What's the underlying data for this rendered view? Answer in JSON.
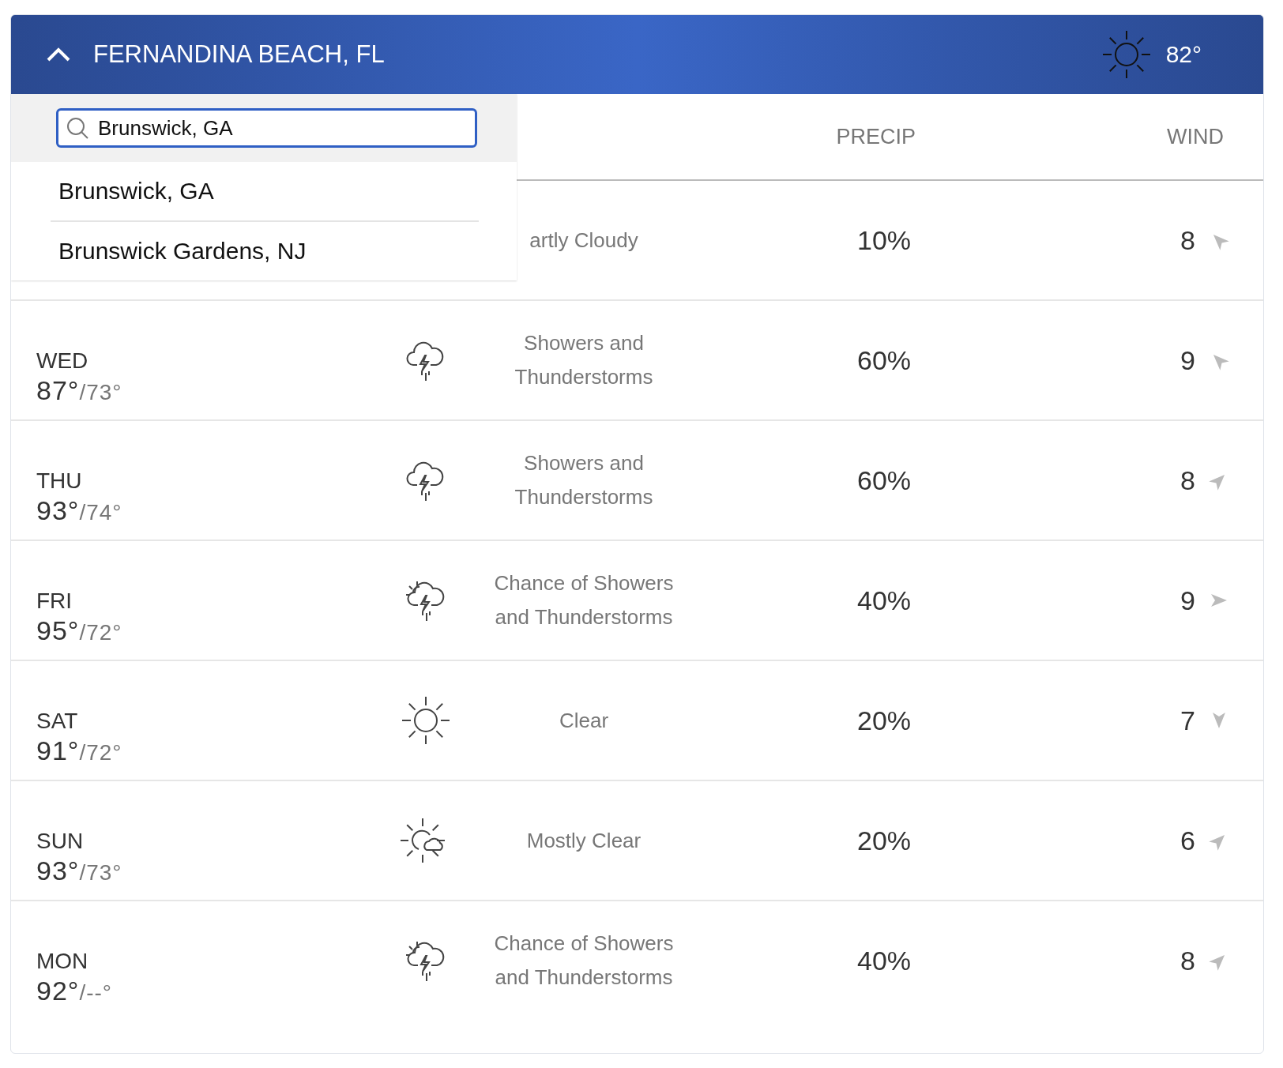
{
  "header": {
    "location": "FERNANDINA BEACH, FL",
    "expanded": true,
    "current": {
      "kind": "clear",
      "temp": "82°"
    }
  },
  "columns": [
    {
      "label": "PRECIP"
    },
    {
      "label": "WIND"
    }
  ],
  "search": {
    "value": "Brunswick, GA",
    "suggestions": [
      "Brunswick, GA",
      "Brunswick Gardens, NJ"
    ]
  },
  "days": [
    {
      "condition": "artly Cloudy",
      "precip": "10%",
      "wind": {
        "speed": "8",
        "kind": "nw"
      }
    },
    {
      "day": "WED",
      "high": "87°",
      "low": "/73°",
      "kind": "storm",
      "condition": "Showers and Thunderstorms",
      "precip": "60%",
      "wind": {
        "speed": "9",
        "kind": "nw"
      }
    },
    {
      "day": "THU",
      "high": "93°",
      "low": "/74°",
      "kind": "storm",
      "condition": "Showers and Thunderstorms",
      "precip": "60%",
      "wind": {
        "speed": "8",
        "kind": "ne"
      }
    },
    {
      "day": "FRI",
      "high": "95°",
      "low": "/72°",
      "kind": "chancestorm",
      "condition": "Chance of Showers and Thunderstorms",
      "precip": "40%",
      "wind": {
        "speed": "9",
        "kind": "e"
      }
    },
    {
      "day": "SAT",
      "high": "91°",
      "low": "/72°",
      "kind": "clear",
      "condition": "Clear",
      "precip": "20%",
      "wind": {
        "speed": "7",
        "kind": "s"
      }
    },
    {
      "day": "SUN",
      "high": "93°",
      "low": "/73°",
      "kind": "mostlyclear",
      "condition": "Mostly Clear",
      "precip": "20%",
      "wind": {
        "speed": "6",
        "kind": "ne"
      }
    },
    {
      "day": "MON",
      "high": "92°",
      "low": "/--°",
      "kind": "chancestorm",
      "condition": "Chance of Showers and Thunderstorms",
      "precip": "40%",
      "wind": {
        "speed": "8",
        "kind": "ne"
      }
    }
  ]
}
